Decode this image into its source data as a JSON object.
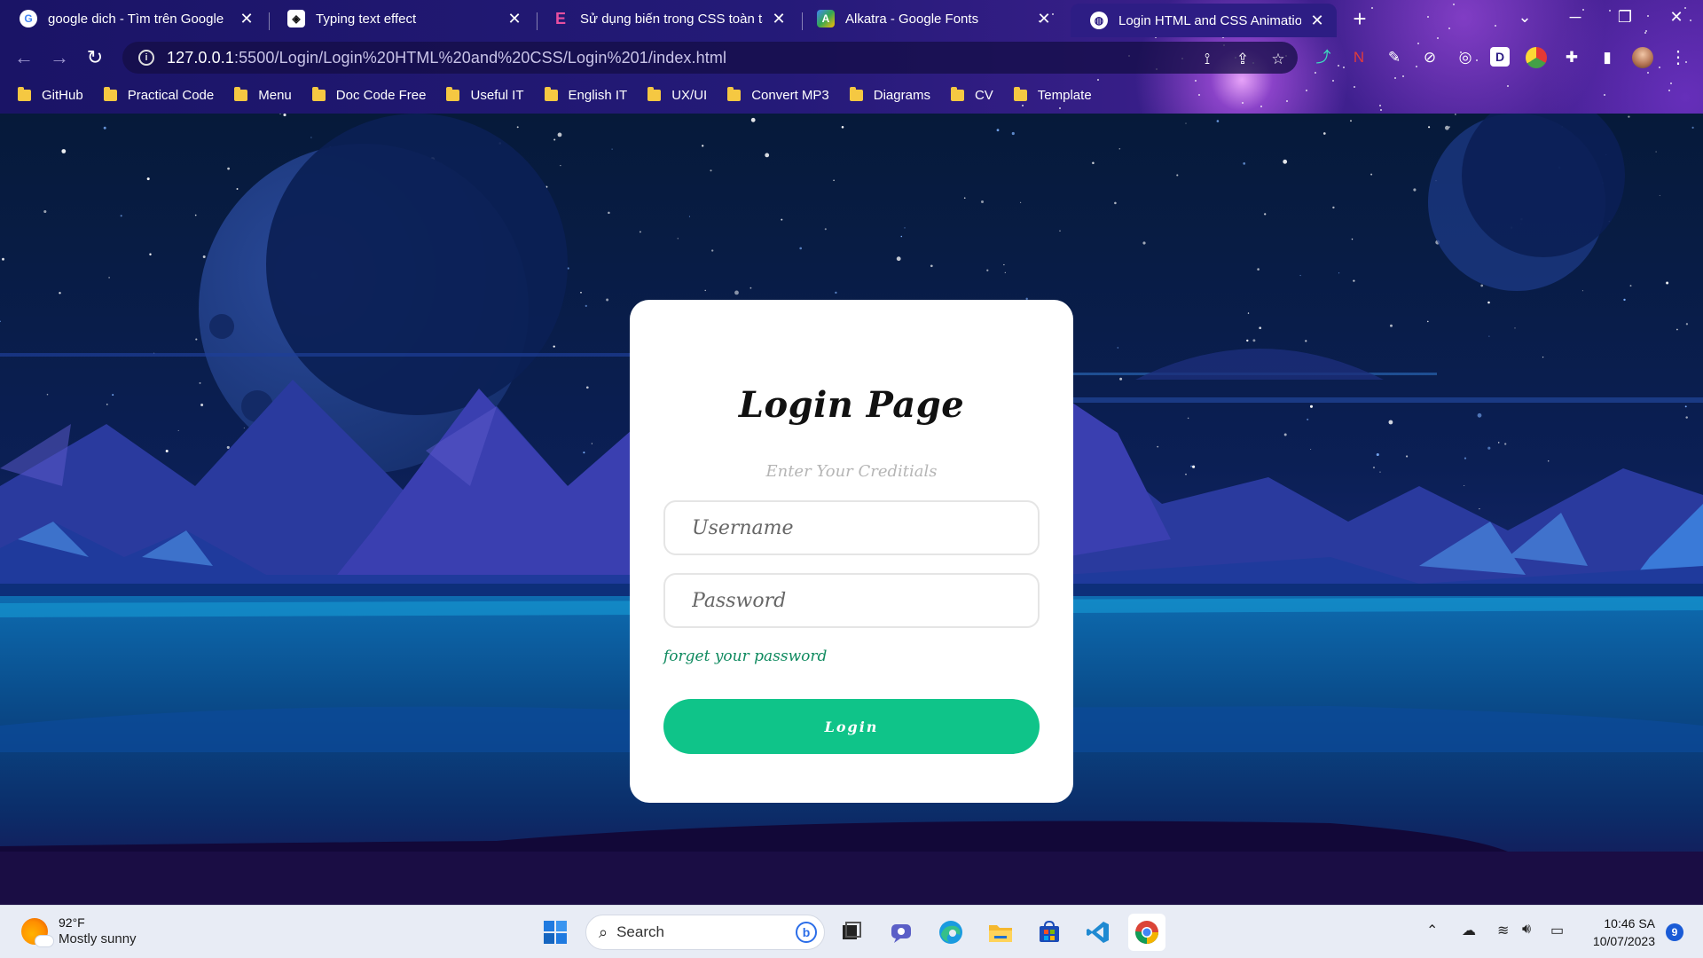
{
  "browser": {
    "tabs": [
      {
        "title": "google dich - Tìm trên Google",
        "icon": "google-icon"
      },
      {
        "title": "Typing text effect",
        "icon": "codepen-icon"
      },
      {
        "title": "Sử dụng biến trong CSS toàn tập",
        "icon": "elementor-icon"
      },
      {
        "title": "Alkatra - Google Fonts",
        "icon": "google-fonts-icon"
      },
      {
        "title": "Login HTML and CSS Animation",
        "icon": "globe-icon",
        "active": true
      }
    ],
    "url_host": "127.0.0.1",
    "url_rest": ":5500/Login/Login%20HTML%20and%20CSS/Login%201/index.html",
    "bookmarks": [
      "GitHub",
      "Practical Code",
      "Menu",
      "Doc Code Free",
      "Useful IT",
      "English IT",
      "UX/UI",
      "Convert MP3",
      "Diagrams",
      "CV",
      "Template"
    ]
  },
  "login": {
    "title": "Login Page",
    "subtitle": "Enter Your Creditials",
    "username_placeholder": "Username",
    "password_placeholder": "Password",
    "forgot_label": "forget your password",
    "button_label": "Login"
  },
  "taskbar": {
    "weather_temp": "92°F",
    "weather_cond": "Mostly sunny",
    "search_label": "Search",
    "time": "10:46 SA",
    "date": "10/07/2023",
    "notifications": "9"
  },
  "colors": {
    "accent": "#0fc489",
    "link": "#0f8a5f",
    "sky_top": "#061a3a",
    "mountains": "#2a3a9e"
  }
}
